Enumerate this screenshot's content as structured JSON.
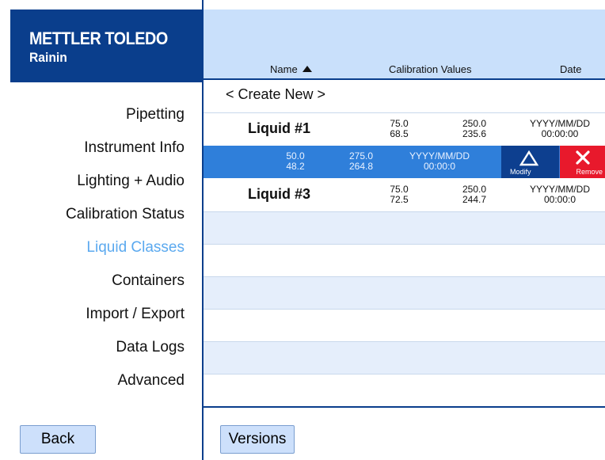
{
  "brand": {
    "line1": "METTLER TOLEDO",
    "line2": "Rainin"
  },
  "sidebar": {
    "items": [
      {
        "label": "Pipetting",
        "active": false
      },
      {
        "label": "Instrument Info",
        "active": false
      },
      {
        "label": "Lighting + Audio",
        "active": false
      },
      {
        "label": "Calibration Status",
        "active": false
      },
      {
        "label": "Liquid Classes",
        "active": true
      },
      {
        "label": "Containers",
        "active": false
      },
      {
        "label": "Import / Export",
        "active": false
      },
      {
        "label": "Data Logs",
        "active": false
      },
      {
        "label": "Advanced",
        "active": false
      }
    ],
    "back_label": "Back"
  },
  "table": {
    "columns": {
      "name": "Name",
      "calibration": "Calibration Values",
      "date": "Date"
    },
    "create_new": "< Create New >",
    "rows": [
      {
        "name": "Liquid #1",
        "c1a": "75.0",
        "c1b": "68.5",
        "c2a": "250.0",
        "c2b": "235.6",
        "date": "YYYY/MM/DD",
        "time": "00:00:00"
      },
      {
        "name": "",
        "c1a": "50.0",
        "c1b": "48.2",
        "c2a": "275.0",
        "c2b": "264.8",
        "date": "YYYY/MM/DD",
        "time": "00:00:0"
      },
      {
        "name": "Liquid #3",
        "c1a": "75.0",
        "c1b": "72.5",
        "c2a": "250.0",
        "c2b": "244.7",
        "date": "YYYY/MM/DD",
        "time": "00:00:0"
      }
    ],
    "modify_label": "Modify",
    "remove_label": "Remove"
  },
  "versions_label": "Versions",
  "colors": {
    "brand": "#0a3e8c",
    "header": "#c9e0fb",
    "selected": "#2f7fda",
    "active_nav": "#5ba9ef",
    "remove": "#e8192c"
  },
  "icons": {
    "modify": "triangle-icon",
    "remove": "x-icon",
    "sort": "sort-ascending-icon"
  }
}
